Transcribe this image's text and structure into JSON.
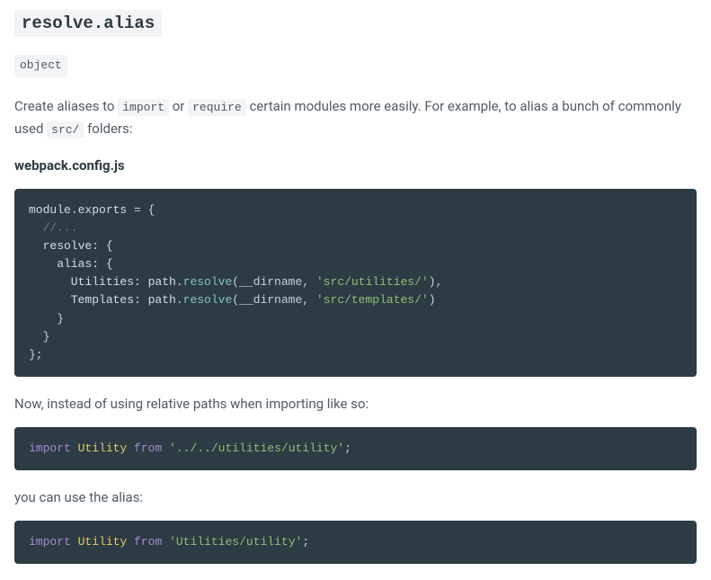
{
  "heading": "resolve.alias",
  "type_badge": "object",
  "intro": {
    "pre1": "Create aliases to ",
    "code1": "import",
    "mid1": " or ",
    "code2": "require",
    "post1": " certain modules more easily. For example, to alias a bunch of commonly used ",
    "code3": "src/",
    "post2": " folders:"
  },
  "file_label": "webpack.config.js",
  "code1": {
    "l1a": "module",
    "l1b": ".",
    "l1c": "exports",
    "l1d": " = {",
    "l2": "  //...",
    "l3": "  resolve: {",
    "l4": "    alias: {",
    "l5a": "      Utilities: path.",
    "l5b": "resolve",
    "l5c": "(__dirname, ",
    "l5d": "'src/utilities/'",
    "l5e": "),",
    "l6a": "      Templates: path.",
    "l6b": "resolve",
    "l6c": "(__dirname, ",
    "l6d": "'src/templates/'",
    "l6e": ")",
    "l7": "    }",
    "l8": "  }",
    "l9": "};"
  },
  "para2": "Now, instead of using relative paths when importing like so:",
  "code2": {
    "kw": "import",
    "sp1": " ",
    "cls": "Utility",
    "sp2": " ",
    "from": "from",
    "sp3": " ",
    "str": "'../../utilities/utility'",
    "semi": ";"
  },
  "para3": "you can use the alias:",
  "code3": {
    "kw": "import",
    "sp1": " ",
    "cls": "Utility",
    "sp2": " ",
    "from": "from",
    "sp3": " ",
    "str": "'Utilities/utility'",
    "semi": ";"
  }
}
